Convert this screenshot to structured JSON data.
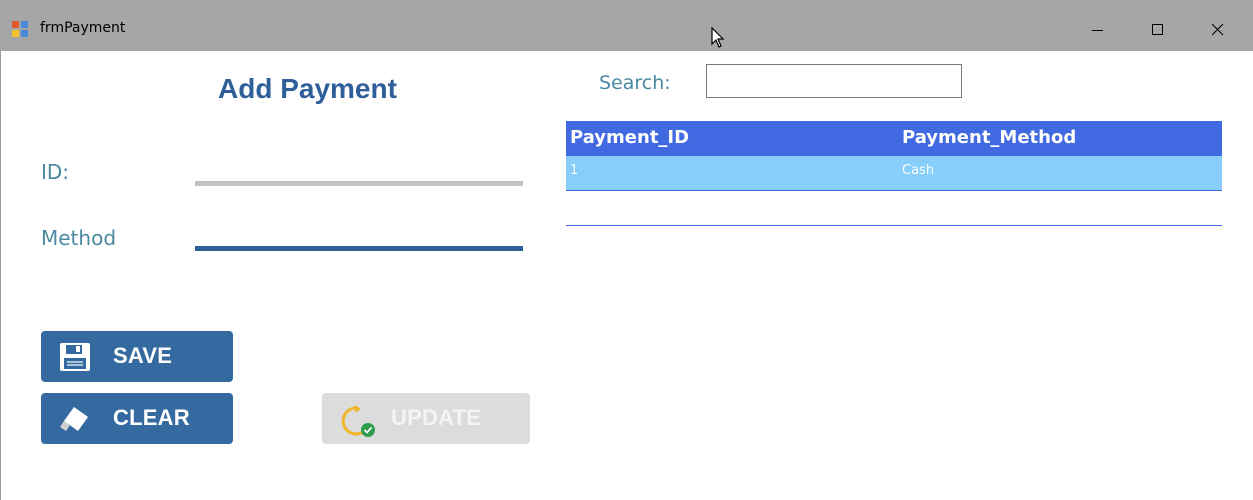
{
  "window": {
    "title": "frmPayment",
    "icon": "winforms-app-icon",
    "controls": [
      "minimize-icon",
      "maximize-icon",
      "close-icon"
    ]
  },
  "form": {
    "heading": "Add Payment",
    "id_label": "ID:",
    "id_value": "",
    "method_label": "Method",
    "method_value": ""
  },
  "search": {
    "label": "Search:",
    "value": ""
  },
  "grid": {
    "columns": [
      "Payment_ID",
      "Payment_Method"
    ],
    "rows": [
      [
        "1",
        "Cash"
      ]
    ]
  },
  "buttons": {
    "save_label": "SAVE",
    "clear_label": "CLEAR",
    "update_label": "UPDATE"
  },
  "colors": {
    "accent": "#356aa0",
    "grid_header": "#4169e1",
    "grid_row": "#87cefa",
    "label_text": "#4a8aa0",
    "disabled": "#dcdcdc"
  }
}
